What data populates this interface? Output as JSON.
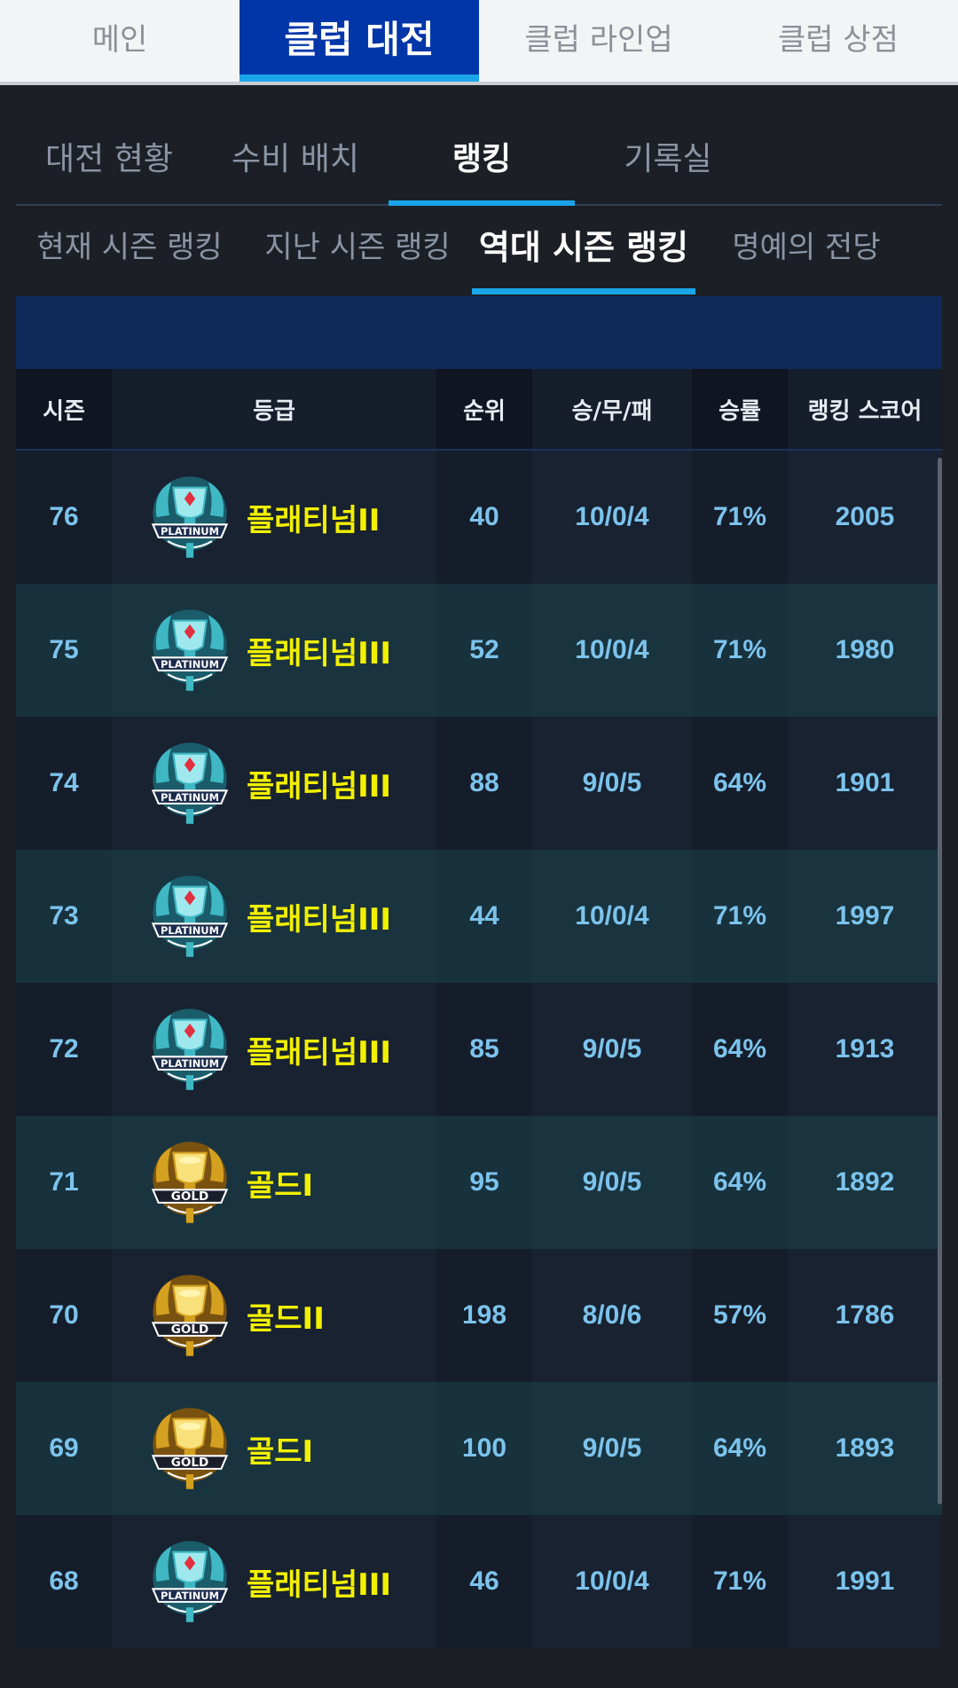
{
  "top_tabs": [
    "메인",
    "클럽 대전",
    "클럽 라인업",
    "클럽 상점"
  ],
  "sub_tabs": [
    "대전 현황",
    "수비 배치",
    "랭킹",
    "기록실"
  ],
  "ranking_tabs": [
    "현재 시즌 랭킹",
    "지난 시즌 랭킹",
    "역대 시즌 랭킹",
    "명예의 전당"
  ],
  "table": {
    "headers": [
      "시즌",
      "등급",
      "순위",
      "승/무/패",
      "승률",
      "랭킹 스코어"
    ],
    "rows": [
      {
        "season": "76",
        "grade": "플래티넘II",
        "badge": "platinum",
        "rank": "40",
        "record": "10/0/4",
        "winrate": "71%",
        "score": "2005"
      },
      {
        "season": "75",
        "grade": "플래티넘III",
        "badge": "platinum",
        "rank": "52",
        "record": "10/0/4",
        "winrate": "71%",
        "score": "1980"
      },
      {
        "season": "74",
        "grade": "플래티넘III",
        "badge": "platinum",
        "rank": "88",
        "record": "9/0/5",
        "winrate": "64%",
        "score": "1901"
      },
      {
        "season": "73",
        "grade": "플래티넘III",
        "badge": "platinum",
        "rank": "44",
        "record": "10/0/4",
        "winrate": "71%",
        "score": "1997"
      },
      {
        "season": "72",
        "grade": "플래티넘III",
        "badge": "platinum",
        "rank": "85",
        "record": "9/0/5",
        "winrate": "64%",
        "score": "1913"
      },
      {
        "season": "71",
        "grade": "골드I",
        "badge": "gold",
        "rank": "95",
        "record": "9/0/5",
        "winrate": "64%",
        "score": "1892"
      },
      {
        "season": "70",
        "grade": "골드II",
        "badge": "gold",
        "rank": "198",
        "record": "8/0/6",
        "winrate": "57%",
        "score": "1786"
      },
      {
        "season": "69",
        "grade": "골드I",
        "badge": "gold",
        "rank": "100",
        "record": "9/0/5",
        "winrate": "64%",
        "score": "1893"
      },
      {
        "season": "68",
        "grade": "플래티넘III",
        "badge": "platinum",
        "rank": "46",
        "record": "10/0/4",
        "winrate": "71%",
        "score": "1991"
      }
    ]
  },
  "badges": {
    "platinum": {
      "label": "PLATINUM",
      "icon": "platinum-trophy-badge-icon",
      "color": "#3fb8c4"
    },
    "gold": {
      "label": "GOLD",
      "icon": "gold-trophy-badge-icon",
      "color": "#d4a020"
    }
  },
  "colors": {
    "accent": "#1aa5ea",
    "active_tab_bg": "#0036a8",
    "grade_text": "#f2f000",
    "value_text": "#7cc3ec"
  }
}
